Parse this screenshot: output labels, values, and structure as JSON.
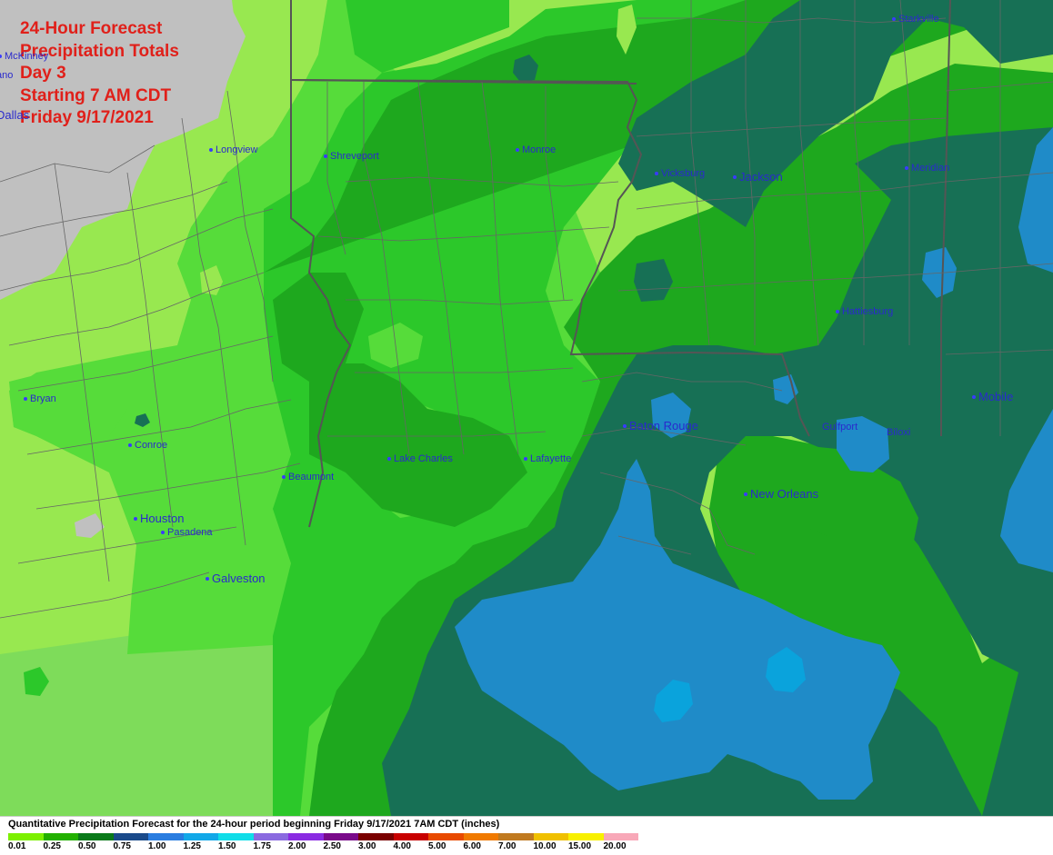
{
  "title_lines": [
    "24-Hour Forecast",
    "Precipitation Totals",
    "Day 3",
    "Starting 7 AM CDT",
    "Friday 9/17/2021"
  ],
  "cities": [
    {
      "name": "McKinney",
      "size": "sm",
      "label": "McKinney"
    },
    {
      "name": "Plano",
      "size": "sm",
      "label": "ano"
    },
    {
      "name": "Dallas",
      "size": "lg",
      "label": "Dallas"
    },
    {
      "name": "Longview",
      "size": "sm",
      "label": "Longview"
    },
    {
      "name": "Shreveport",
      "size": "sm",
      "label": "Shreveport"
    },
    {
      "name": "Monroe",
      "size": "sm",
      "label": "Monroe"
    },
    {
      "name": "Vicksburg",
      "size": "sm",
      "label": "Vicksburg"
    },
    {
      "name": "Jackson",
      "size": "lg",
      "label": "Jackson"
    },
    {
      "name": "Starkville",
      "size": "sm",
      "label": "Starkville"
    },
    {
      "name": "Meridian",
      "size": "sm",
      "label": "Meridian"
    },
    {
      "name": "Hattiesburg",
      "size": "sm",
      "label": "Hattiesburg"
    },
    {
      "name": "Mobile",
      "size": "lg",
      "label": "Mobile"
    },
    {
      "name": "Bryan",
      "size": "sm",
      "label": "Bryan"
    },
    {
      "name": "Conroe",
      "size": "sm",
      "label": "Conroe"
    },
    {
      "name": "Beaumont",
      "size": "sm",
      "label": "Beaumont"
    },
    {
      "name": "Lake Charles",
      "size": "sm",
      "label": "Lake Charles"
    },
    {
      "name": "Lafayette",
      "size": "sm",
      "label": "Lafayette"
    },
    {
      "name": "Baton Rouge",
      "size": "lg",
      "label": "Baton Rouge"
    },
    {
      "name": "Gulfport",
      "size": "sm",
      "label": "Gulfport"
    },
    {
      "name": "Biloxi",
      "size": "sm",
      "label": "Biloxi"
    },
    {
      "name": "New Orleans",
      "size": "lg",
      "label": "New Orleans"
    },
    {
      "name": "Houston",
      "size": "lg",
      "label": "Houston"
    },
    {
      "name": "Pasadena",
      "size": "sm",
      "label": "Pasadena"
    },
    {
      "name": "Galveston",
      "size": "lg",
      "label": "Galveston"
    }
  ],
  "legend": {
    "title": "Quantitative Precipitation Forecast for the 24-hour period beginning Friday 9/17/2021 7AM CDT (inches)",
    "items": [
      {
        "label": "0.01",
        "color": "#7cf000"
      },
      {
        "label": "0.25",
        "color": "#22b000"
      },
      {
        "label": "0.50",
        "color": "#0a7a1a"
      },
      {
        "label": "0.75",
        "color": "#1a4a8a"
      },
      {
        "label": "1.00",
        "color": "#2a7de0"
      },
      {
        "label": "1.25",
        "color": "#12a8e8"
      },
      {
        "label": "1.50",
        "color": "#10dde8"
      },
      {
        "label": "1.75",
        "color": "#8a6ae0"
      },
      {
        "label": "2.00",
        "color": "#8a2be2"
      },
      {
        "label": "2.50",
        "color": "#7a0a8a"
      },
      {
        "label": "3.00",
        "color": "#7a0000"
      },
      {
        "label": "4.00",
        "color": "#c80000"
      },
      {
        "label": "5.00",
        "color": "#e84a00"
      },
      {
        "label": "6.00",
        "color": "#f07a00"
      },
      {
        "label": "7.00",
        "color": "#c07a20"
      },
      {
        "label": "10.00",
        "color": "#f0c000"
      },
      {
        "label": "15.00",
        "color": "#f8f000"
      },
      {
        "label": "20.00",
        "color": "#f8a8b8"
      }
    ]
  },
  "fill_colors": {
    "no_precip": "#c0c0c0",
    "trace_light": "#98e850",
    "light_green": "#56dc3a",
    "medium_green": "#2cc82a",
    "green": "#1ea81e",
    "dark_teal": "#177055",
    "blue": "#1f8bc8",
    "cyan": "#0aa3dc"
  }
}
